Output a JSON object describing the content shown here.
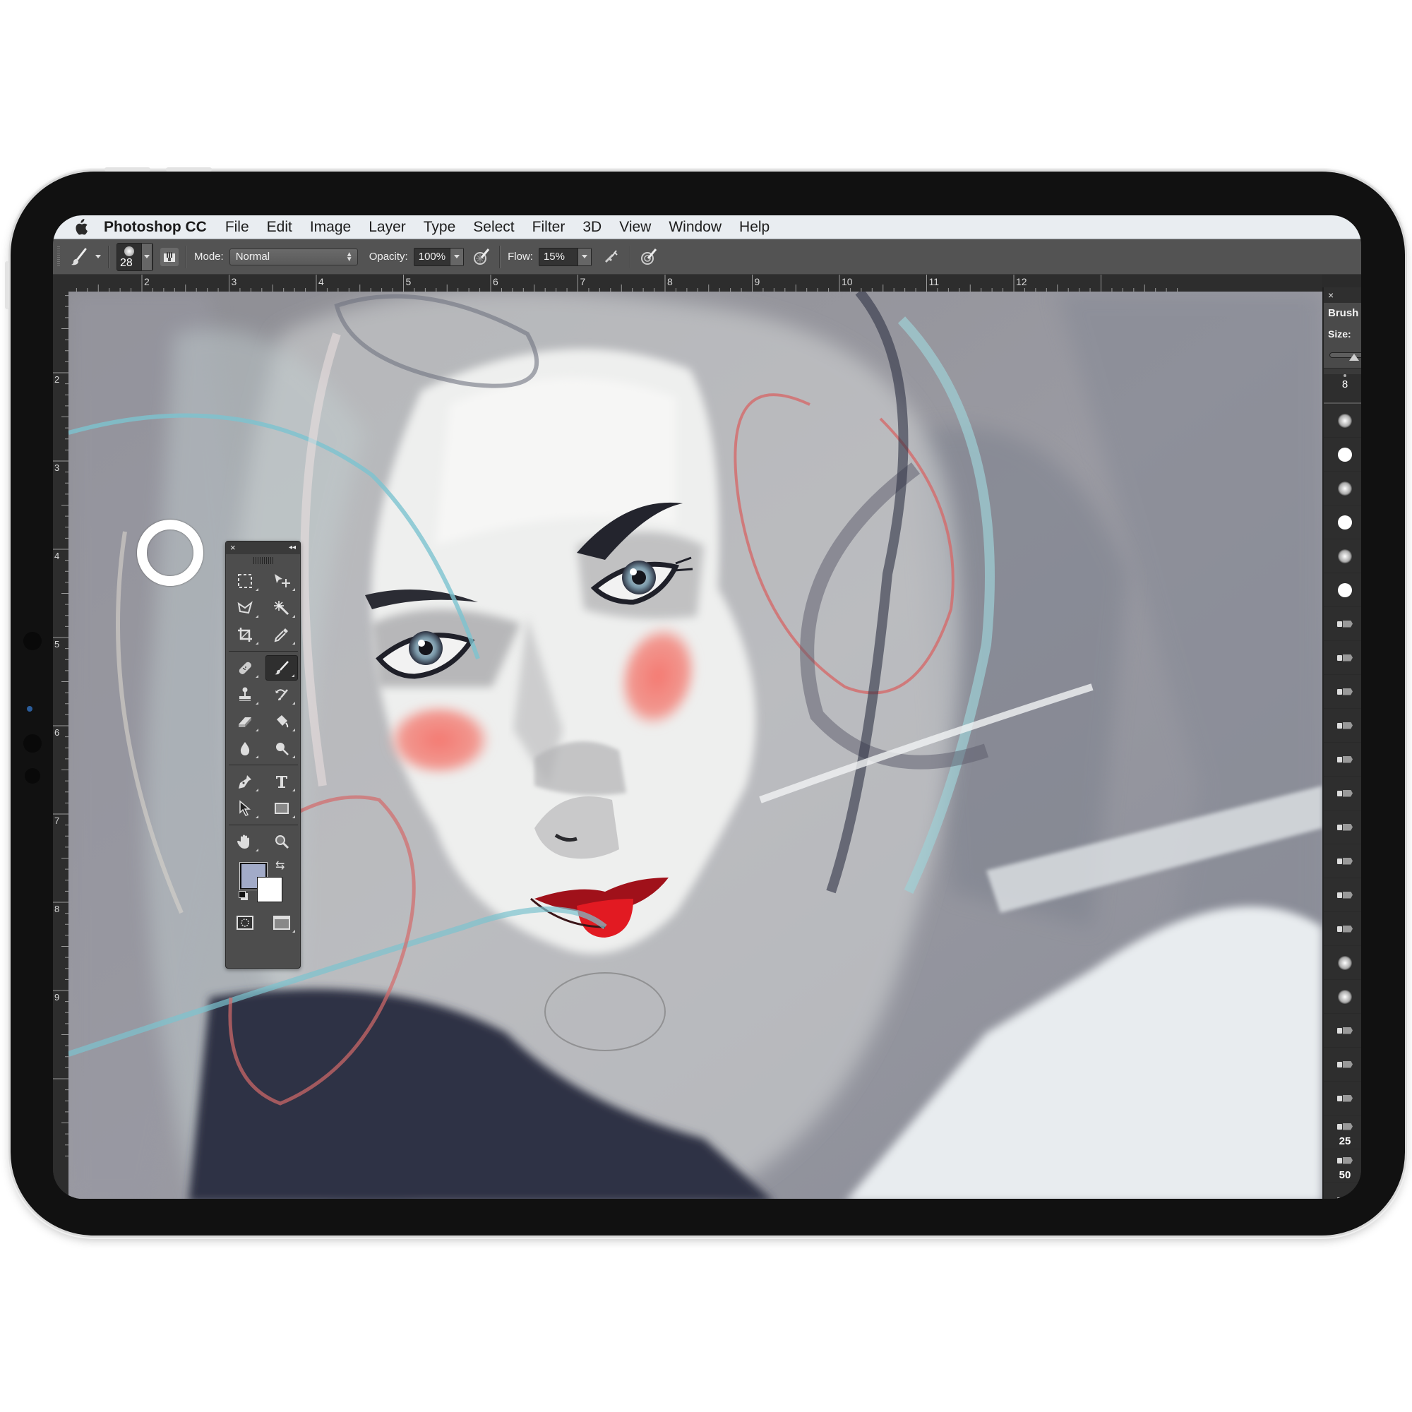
{
  "menubar": {
    "app_name": "Photoshop CC",
    "items": [
      "File",
      "Edit",
      "Image",
      "Layer",
      "Type",
      "Select",
      "Filter",
      "3D",
      "View",
      "Window",
      "Help"
    ]
  },
  "options_bar": {
    "tool_icon": "brush-icon",
    "brush_size": "28",
    "mode_label": "Mode:",
    "mode_value": "Normal",
    "opacity_label": "Opacity:",
    "opacity_value": "100%",
    "flow_label": "Flow:",
    "flow_value": "15%",
    "icons": [
      "toggle-brush-panel-icon",
      "pressure-opacity-icon",
      "airbrush-icon",
      "pressure-size-icon"
    ]
  },
  "rulers": {
    "top_labels": [
      "2",
      "3",
      "4",
      "5",
      "6",
      "7",
      "8",
      "9",
      "10",
      "11",
      "12"
    ],
    "left_labels": [
      "2",
      "3",
      "4",
      "5",
      "6",
      "7",
      "8",
      "9"
    ]
  },
  "tools_panel": {
    "close_glyph": "×",
    "collapse_glyph": "◂◂",
    "tools": [
      "rectangular-marquee-tool",
      "move-tool",
      "lasso-tool",
      "magic-wand-tool",
      "crop-tool",
      "eyedropper-tool",
      "spot-healing-brush-tool",
      "brush-tool",
      "clone-stamp-tool",
      "history-brush-tool",
      "eraser-tool",
      "paint-bucket-tool",
      "blur-tool",
      "dodge-tool",
      "pen-tool",
      "type-tool",
      "path-selection-tool",
      "rectangle-tool",
      "hand-tool",
      "zoom-tool"
    ],
    "active_tool": "brush-tool",
    "foreground_color": "#a2abc8",
    "background_color": "#ffffff",
    "bottom": [
      "quick-mask-mode",
      "screen-mode"
    ]
  },
  "brush_panel": {
    "close_glyph": "×",
    "title": "Brush",
    "size_label": "Size:",
    "selected_size": "8",
    "presets": [
      {
        "type": "soft",
        "label": ""
      },
      {
        "type": "hard",
        "label": ""
      },
      {
        "type": "soft",
        "label": ""
      },
      {
        "type": "hard",
        "label": ""
      },
      {
        "type": "soft",
        "label": ""
      },
      {
        "type": "hard",
        "label": ""
      },
      {
        "type": "bristle",
        "label": ""
      },
      {
        "type": "bristle",
        "label": ""
      },
      {
        "type": "bristle",
        "label": ""
      },
      {
        "type": "bristle",
        "label": ""
      },
      {
        "type": "bristle",
        "label": ""
      },
      {
        "type": "bristle",
        "label": ""
      },
      {
        "type": "bristle",
        "label": ""
      },
      {
        "type": "bristle",
        "label": ""
      },
      {
        "type": "bristle",
        "label": ""
      },
      {
        "type": "bristle",
        "label": ""
      },
      {
        "type": "soft",
        "label": ""
      },
      {
        "type": "soft",
        "label": ""
      },
      {
        "type": "bristle",
        "label": ""
      },
      {
        "type": "bristle",
        "label": ""
      },
      {
        "type": "bristle",
        "label": ""
      },
      {
        "type": "bristle",
        "label": "25"
      },
      {
        "type": "bristle",
        "label": "50"
      },
      {
        "type": "bristle",
        "label": ""
      }
    ]
  },
  "canvas": {
    "artwork": "painted portrait of a woman with red lips and rosy cheeks",
    "colors": {
      "bg": "#8f8f94",
      "skin": "#f2f2f0",
      "lips": "#d8141b",
      "blush": "#f08a80",
      "hair_blue": "#8fc4cc",
      "dark": "#2e3344",
      "accent_red": "#d46a6a"
    }
  }
}
